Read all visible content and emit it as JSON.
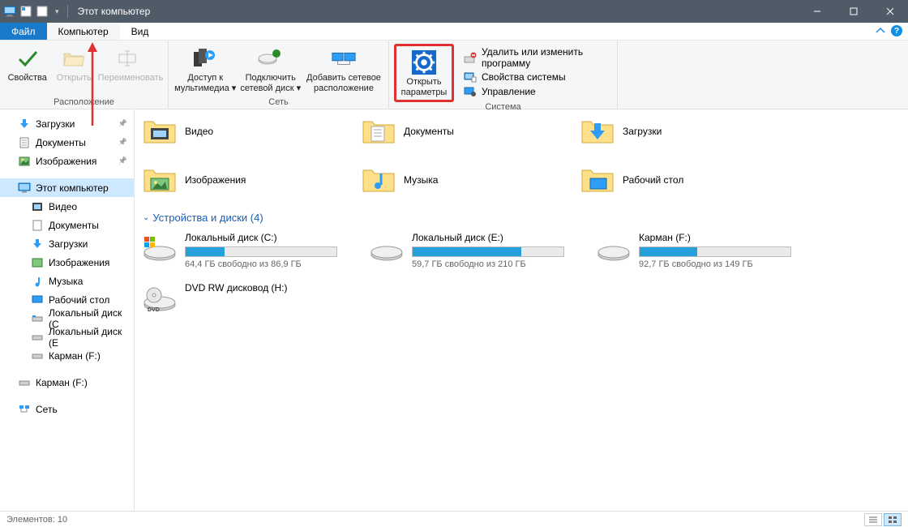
{
  "window": {
    "title": "Этот компьютер"
  },
  "menu": {
    "file": "Файл",
    "computer": "Компьютер",
    "view": "Вид"
  },
  "ribbon": {
    "location": {
      "properties": "Свойства",
      "open": "Открыть",
      "rename": "Переименовать",
      "group": "Расположение"
    },
    "network": {
      "media": "Доступ к мультимедиа",
      "map_drive": "Подключить сетевой диск",
      "add_location": "Добавить сетевое расположение",
      "group": "Сеть"
    },
    "settings": {
      "open_settings_l1": "Открыть",
      "open_settings_l2": "параметры"
    },
    "system": {
      "uninstall": "Удалить или изменить программу",
      "sys_props": "Свойства системы",
      "manage": "Управление",
      "group": "Система"
    }
  },
  "sidebar": {
    "downloads": "Загрузки",
    "documents": "Документы",
    "pictures": "Изображения",
    "this_pc": "Этот компьютер",
    "videos": "Видео",
    "documents2": "Документы",
    "downloads2": "Загрузки",
    "pictures2": "Изображения",
    "music": "Музыка",
    "desktop": "Рабочий стол",
    "disk_c": "Локальный диск (C",
    "disk_e": "Локальный диск (E",
    "disk_f": "Карман (F:)",
    "disk_f2": "Карман (F:)",
    "network": "Сеть"
  },
  "folders": {
    "videos": "Видео",
    "documents": "Документы",
    "downloads": "Загрузки",
    "pictures": "Изображения",
    "music": "Музыка",
    "desktop": "Рабочий стол"
  },
  "drives_header": "Устройства и диски (4)",
  "drives": {
    "c": {
      "name": "Локальный диск (C:)",
      "free": "64,4 ГБ свободно из 86,9 ГБ",
      "fill": 26
    },
    "e": {
      "name": "Локальный диск (E:)",
      "free": "59,7 ГБ свободно из 210 ГБ",
      "fill": 72
    },
    "f": {
      "name": "Карман (F:)",
      "free": "92,7 ГБ свободно из 149 ГБ",
      "fill": 38
    },
    "dvd": {
      "name": "DVD RW дисковод (H:)"
    }
  },
  "status": {
    "items": "Элементов: 10"
  }
}
